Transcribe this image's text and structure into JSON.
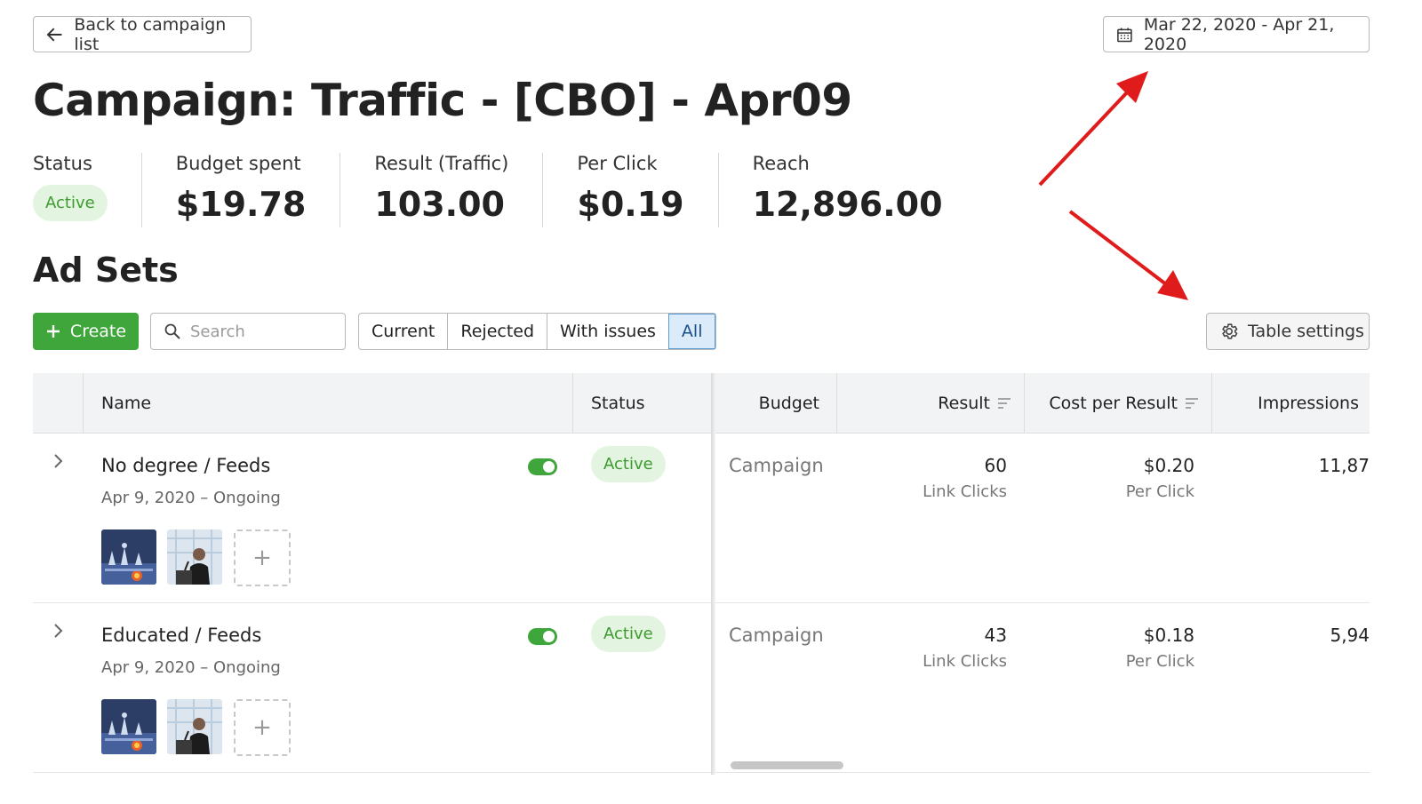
{
  "header": {
    "back_label": "Back to campaign list",
    "date_range": "Mar 22, 2020 - Apr 21, 2020"
  },
  "page": {
    "title": "Campaign: Traffic - [CBO] - Apr09"
  },
  "stats": {
    "status": {
      "label": "Status",
      "value": "Active"
    },
    "budget": {
      "label": "Budget spent",
      "value": "$19.78"
    },
    "result": {
      "label": "Result (Traffic)",
      "value": "103.00"
    },
    "per_click": {
      "label": "Per Click",
      "value": "$0.19"
    },
    "reach": {
      "label": "Reach",
      "value": "12,896.00"
    }
  },
  "adsets": {
    "title": "Ad Sets",
    "create_label": "Create",
    "search_placeholder": "Search",
    "filters": [
      "Current",
      "Rejected",
      "With issues",
      "All"
    ],
    "selected_filter": "All",
    "settings_label": "Table settings"
  },
  "table": {
    "columns": [
      "Name",
      "Status",
      "Budget",
      "Result",
      "Cost per Result",
      "Impressions"
    ],
    "rows": [
      {
        "name": "No degree / Feeds",
        "date": "Apr 9, 2020 – Ongoing",
        "status": "Active",
        "budget": "Campaign",
        "result": "60",
        "result_sub": "Link Clicks",
        "cost": "$0.20",
        "cost_sub": "Per Click",
        "impressions": "11,87"
      },
      {
        "name": "Educated / Feeds",
        "date": "Apr 9, 2020 – Ongoing",
        "status": "Active",
        "budget": "Campaign",
        "result": "43",
        "result_sub": "Link Clicks",
        "cost": "$0.18",
        "cost_sub": "Per Click",
        "impressions": "5,94"
      }
    ]
  },
  "colors": {
    "accent_green": "#3ea63a",
    "badge_bg": "#e3f5e0",
    "badge_text": "#3d9a2f",
    "selected_filter_bg": "#dcebfa",
    "annotation_arrow": "#e01b1b"
  },
  "icons": {
    "back": "arrow-left-icon",
    "date": "calendar-icon",
    "create": "plus-icon",
    "search": "search-icon",
    "settings": "gear-icon",
    "expand": "chevron-right-icon",
    "sort": "sort-icon"
  }
}
